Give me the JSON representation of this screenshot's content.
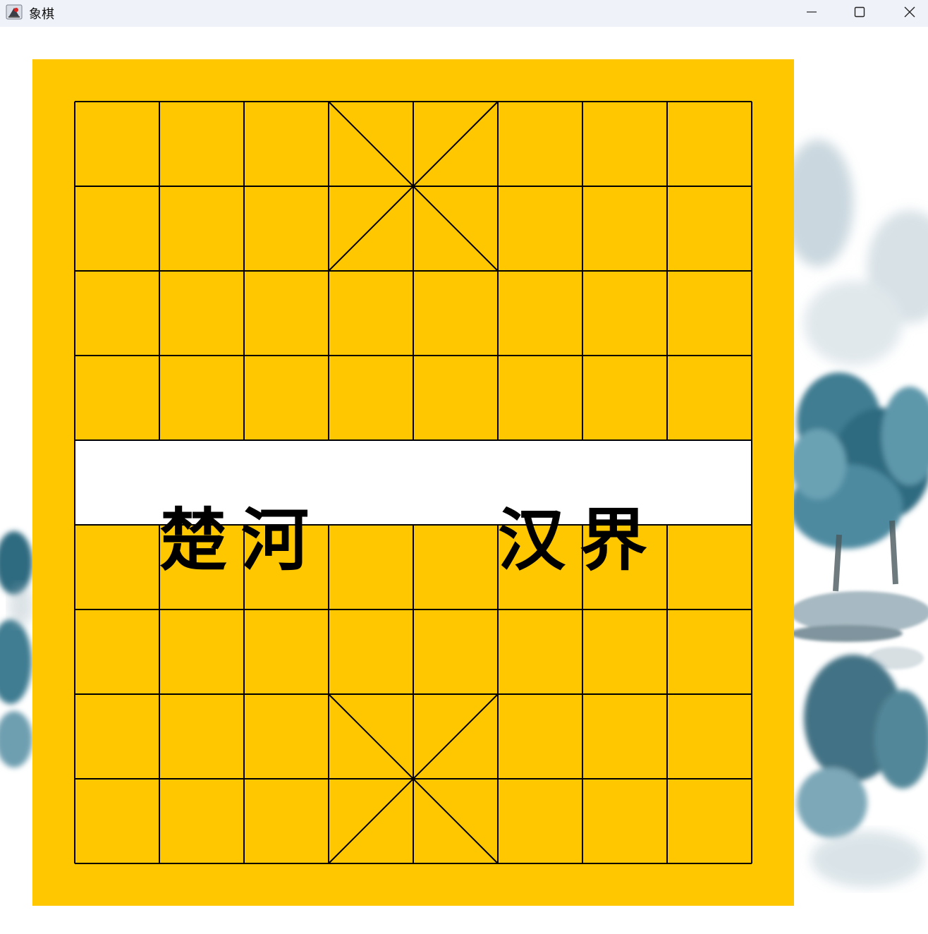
{
  "window": {
    "title": "象棋",
    "icon": "java-app-icon",
    "controls": {
      "minimize": "minimize-icon",
      "maximize": "maximize-icon",
      "close": "close-icon"
    }
  },
  "board": {
    "files": 9,
    "ranks": 10,
    "board_color": "#ffc700",
    "line_color": "#000000",
    "river_color": "#ffffff",
    "river": {
      "left_text": "楚河",
      "right_text": "汉界"
    },
    "pieces": []
  }
}
